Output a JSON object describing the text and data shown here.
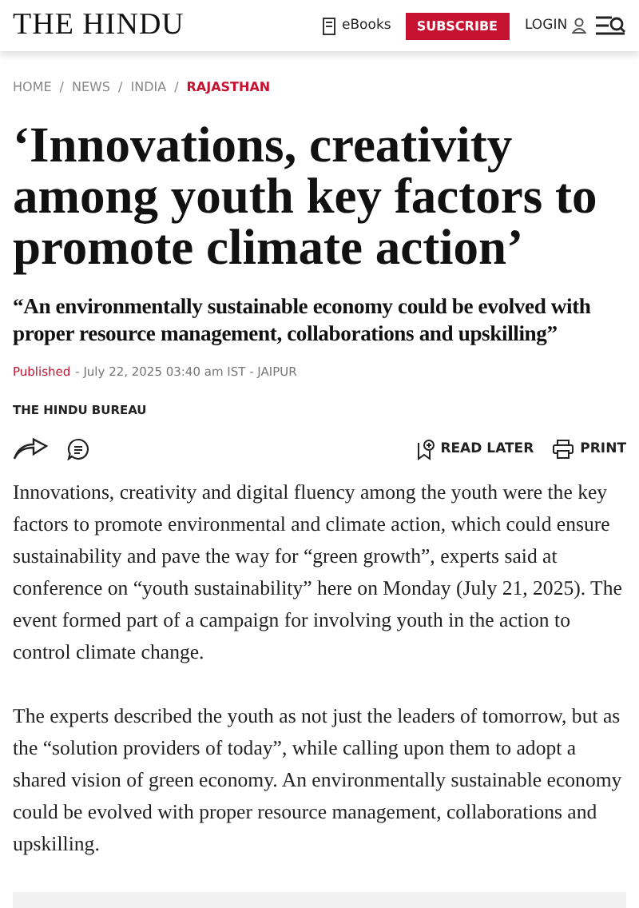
{
  "header": {
    "logo": "THE HINDU",
    "ebooks": "eBooks",
    "subscribe": "SUBSCRIBE",
    "login": "LOGIN"
  },
  "breadcrumb_separator": "/",
  "breadcrumb": [
    {
      "label": "HOME",
      "selected": false
    },
    {
      "label": "NEWS",
      "selected": false
    },
    {
      "label": "INDIA",
      "selected": false
    },
    {
      "label": "RAJASTHAN",
      "selected": true
    }
  ],
  "headline": "‘Innovations, creativity among youth key factors to promote climate action’",
  "subheadline": "“An environmentally sustainable economy could be evolved with proper resource management, collaborations and upskilling”",
  "published": {
    "label": "Published",
    "text": "- July 22, 2025 03:40 am IST - JAIPUR"
  },
  "byline": "THE HINDU BUREAU",
  "actions": {
    "read_later": "READ LATER",
    "print": "PRINT"
  },
  "paragraphs": [
    "Innovations, creativity and digital fluency among the youth were the key factors to promote environmental and climate action, which could ensure sustainability and pave the way for “green growth”, experts said at conference on “youth sustainability” here on Monday (July 21, 2025). The event formed part of a campaign for involving youth in the action to control climate change.",
    "The experts described the youth as not just the leaders of tomorrow, but as the “solution providers of today”, while calling upon them to adopt a shared vision of green economy. An environmentally sustainable economy could be evolved with proper resource management, collaborations and upskilling."
  ]
}
